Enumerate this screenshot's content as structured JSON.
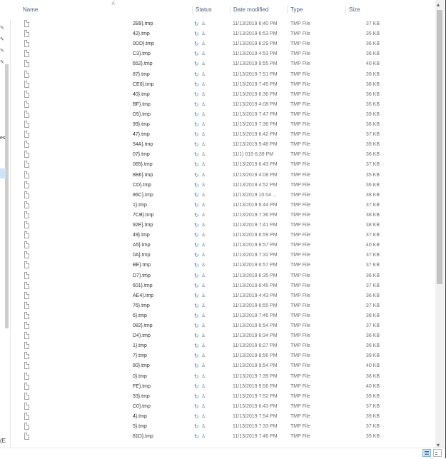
{
  "columns": {
    "name": "Name",
    "status": "Status",
    "date": "Date modified",
    "type": "Type",
    "size": "Size"
  },
  "leftnav": {
    "frag1": "es",
    "bottom": "(E"
  },
  "rows": [
    {
      "name": "2B9}.tmp",
      "date": "11/13/2019 6:40 PM",
      "type": "TMP File",
      "size": "37 KB"
    },
    {
      "name": "42}.tmp",
      "date": "11/13/2019 6:53 PM",
      "type": "TMP File",
      "size": "35 KB"
    },
    {
      "name": "0DD}.tmp",
      "date": "11/13/2019 6:29 PM",
      "type": "TMP File",
      "size": "36 KB"
    },
    {
      "name": "C3}.tmp",
      "date": "11/13/2019 4:53 PM",
      "type": "TMP File",
      "size": "36 KB"
    },
    {
      "name": "652}.tmp",
      "date": "11/13/2019 9:55 PM",
      "type": "TMP File",
      "size": "40 KB"
    },
    {
      "name": "87}.tmp",
      "date": "11/13/2019 7:51 PM",
      "type": "TMP File",
      "size": "39 KB"
    },
    {
      "name": "CE6}.tmp",
      "date": "11/13/2019 7:45 PM",
      "type": "TMP File",
      "size": "38 KB"
    },
    {
      "name": "40}.tmp",
      "date": "11/13/2019 6:36 PM",
      "type": "TMP File",
      "size": "36 KB"
    },
    {
      "name": "BF}.tmp",
      "date": "11/13/2019 4:08 PM",
      "type": "TMP File",
      "size": "35 KB"
    },
    {
      "name": "D5}.tmp",
      "date": "11/13/2019 7:47 PM",
      "type": "TMP File",
      "size": "39 KB"
    },
    {
      "name": "99}.tmp",
      "date": "11/13/2019 7:38 PM",
      "type": "TMP File",
      "size": "38 KB"
    },
    {
      "name": "47}.tmp",
      "date": "11/13/2019 6:42 PM",
      "type": "TMP File",
      "size": "37 KB"
    },
    {
      "name": "54A}.tmp",
      "date": "11/13/2019 9:48 PM",
      "type": "TMP File",
      "size": "39 KB"
    },
    {
      "name": "07}.tmp",
      "date": "11/1) 019 6:39 PM",
      "type": "TMP File",
      "size": "36 KB"
    },
    {
      "name": "065}.tmp",
      "date": "11/13/2019 6:43 PM",
      "type": "TMP File",
      "size": "37 KB"
    },
    {
      "name": "8B6}.tmp",
      "date": "11/13/2019 4:08 PM",
      "type": "TMP File",
      "size": "35 KB"
    },
    {
      "name": "CD}.tmp",
      "date": "11/13/2019 4:52 PM",
      "type": "TMP File",
      "size": "36 KB"
    },
    {
      "name": "86C}.tmp",
      "date": "11/13/2019 10:04 ...",
      "type": "TMP File",
      "size": "38 KB"
    },
    {
      "name": "1}.tmp",
      "date": "11/13/2019 6:44 PM",
      "type": "TMP File",
      "size": "37 KB"
    },
    {
      "name": "7CB}.tmp",
      "date": "11/13/2019 7:36 PM",
      "type": "TMP File",
      "size": "38 KB"
    },
    {
      "name": "92E}.tmp",
      "date": "11/13/2019 7:41 PM",
      "type": "TMP File",
      "size": "38 KB"
    },
    {
      "name": "49}.tmp",
      "date": "11/13/2019 6:59 PM",
      "type": "TMP File",
      "size": "37 KB"
    },
    {
      "name": "A5}.tmp",
      "date": "11/13/2019 9:57 PM",
      "type": "TMP File",
      "size": "40 KB"
    },
    {
      "name": "0A}.tmp",
      "date": "11/13/2019 7:32 PM",
      "type": "TMP File",
      "size": "37 KB"
    },
    {
      "name": "BE}.tmp",
      "date": "11/13/2019 6:57 PM",
      "type": "TMP File",
      "size": "37 KB"
    },
    {
      "name": "D7}.tmp",
      "date": "11/13/2019 6:35 PM",
      "type": "TMP File",
      "size": "36 KB"
    },
    {
      "name": "601}.tmp",
      "date": "11/13/2019 6:45 PM",
      "type": "TMP File",
      "size": "37 KB"
    },
    {
      "name": "AE4}.tmp",
      "date": "11/13/2019 4:43 PM",
      "type": "TMP File",
      "size": "36 KB"
    },
    {
      "name": "76}.tmp",
      "date": "11/13/2019 6:55 PM",
      "type": "TMP File",
      "size": "37 KB"
    },
    {
      "name": "6}.tmp",
      "date": "11/13/2019 7:46 PM",
      "type": "TMP File",
      "size": "38 KB"
    },
    {
      "name": "082}.tmp",
      "date": "11/13/2019 6:54 PM",
      "type": "TMP File",
      "size": "37 KB"
    },
    {
      "name": "D4}.tmp",
      "date": "11/13/2019 6:34 PM",
      "type": "TMP File",
      "size": "36 KB"
    },
    {
      "name": "1}.tmp",
      "date": "11/13/2019 6:27 PM",
      "type": "TMP File",
      "size": "36 KB"
    },
    {
      "name": "7}.tmp",
      "date": "11/13/2019 8:56 PM",
      "type": "TMP File",
      "size": "39 KB"
    },
    {
      "name": "80}.tmp",
      "date": "11/13/2019 9:54 PM",
      "type": "TMP File",
      "size": "40 KB"
    },
    {
      "name": "0}.tmp",
      "date": "11/13/2019 7:39 PM",
      "type": "TMP File",
      "size": "38 KB"
    },
    {
      "name": "FE}.tmp",
      "date": "11/13/2019 9:56 PM",
      "type": "TMP File",
      "size": "40 KB"
    },
    {
      "name": "33}.tmp",
      "date": "11/13/2019 7:52 PM",
      "type": "TMP File",
      "size": "39 KB"
    },
    {
      "name": "C0}.tmp",
      "date": "11/13/2019 6:43 PM",
      "type": "TMP File",
      "size": "37 KB"
    },
    {
      "name": "4}.tmp",
      "date": "11/13/2019 7:54 PM",
      "type": "TMP File",
      "size": "39 KB"
    },
    {
      "name": "5}.tmp",
      "date": "11/13/2019 7:33 PM",
      "type": "TMP File",
      "size": "37 KB"
    },
    {
      "name": "81D}.tmp",
      "date": "11/13/2019 7:46 PM",
      "type": "TMP File",
      "size": "39 KB"
    }
  ],
  "icons": {
    "sync": "sync-icon",
    "people": "shared-people-icon",
    "file": "file-icon",
    "sort": "sort-up-icon"
  },
  "colors": {
    "sync": "#1f7fd8",
    "header_text": "#4d6082",
    "selection": "#cce4f7"
  }
}
